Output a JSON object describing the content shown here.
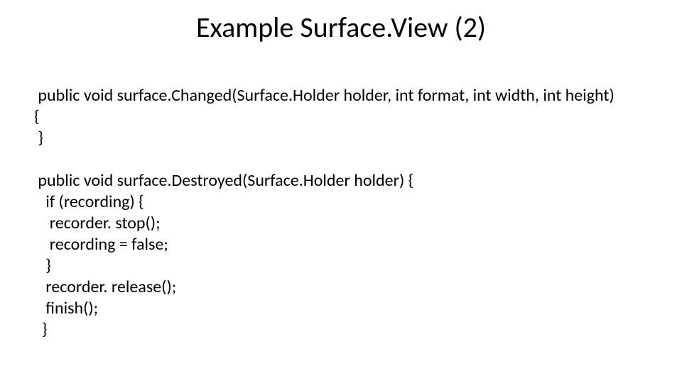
{
  "title": "Example Surface.View (2)",
  "code": " public void surface.Changed(Surface.Holder holder, int format, int width, int height)\n{\n }\n\n public void surface.Destroyed(Surface.Holder holder) {\n   if (recording) {\n    recorder. stop();\n    recording = false;\n   }\n   recorder. release();\n   finish();\n  }"
}
